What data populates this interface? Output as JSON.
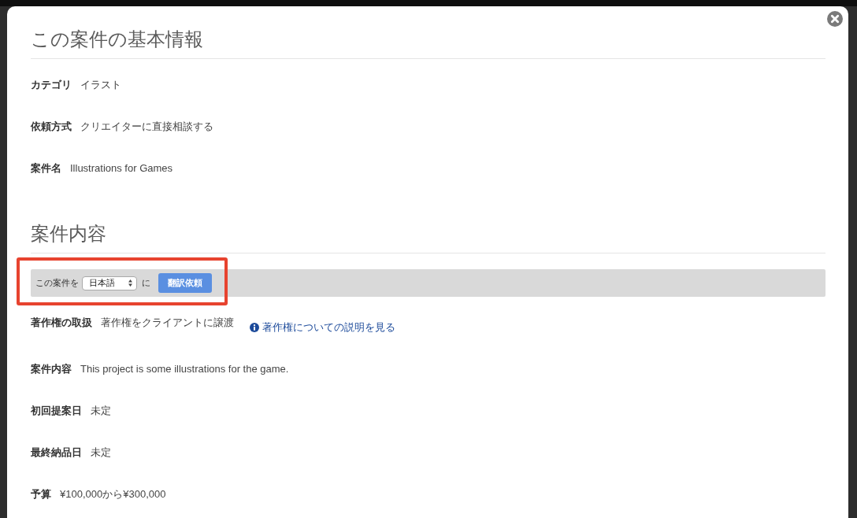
{
  "modal": {
    "sections": [
      {
        "title": "この案件の基本情報",
        "fields": [
          {
            "label": "カテゴリ",
            "value": "イラスト"
          },
          {
            "label": "依頼方式",
            "value": "クリエイターに直接相談する"
          },
          {
            "label": "案件名",
            "value": "Illustrations for Games"
          }
        ]
      },
      {
        "title": "案件内容",
        "translation_bar": {
          "prefix": "この案件を",
          "language_select": {
            "value": "日本語"
          },
          "suffix": "に",
          "button": "翻訳依頼"
        },
        "fields": [
          {
            "label": "著作権の取扱",
            "value": "著作権をクライアントに譲渡",
            "link": "著作権についての説明を見る"
          },
          {
            "label": "案件内容",
            "value": "This project is some illustrations for the game."
          },
          {
            "label": "初回提案日",
            "value": "未定"
          },
          {
            "label": "最終納品日",
            "value": "未定"
          },
          {
            "label": "予算",
            "value": "¥100,000から¥300,000"
          }
        ]
      }
    ]
  }
}
